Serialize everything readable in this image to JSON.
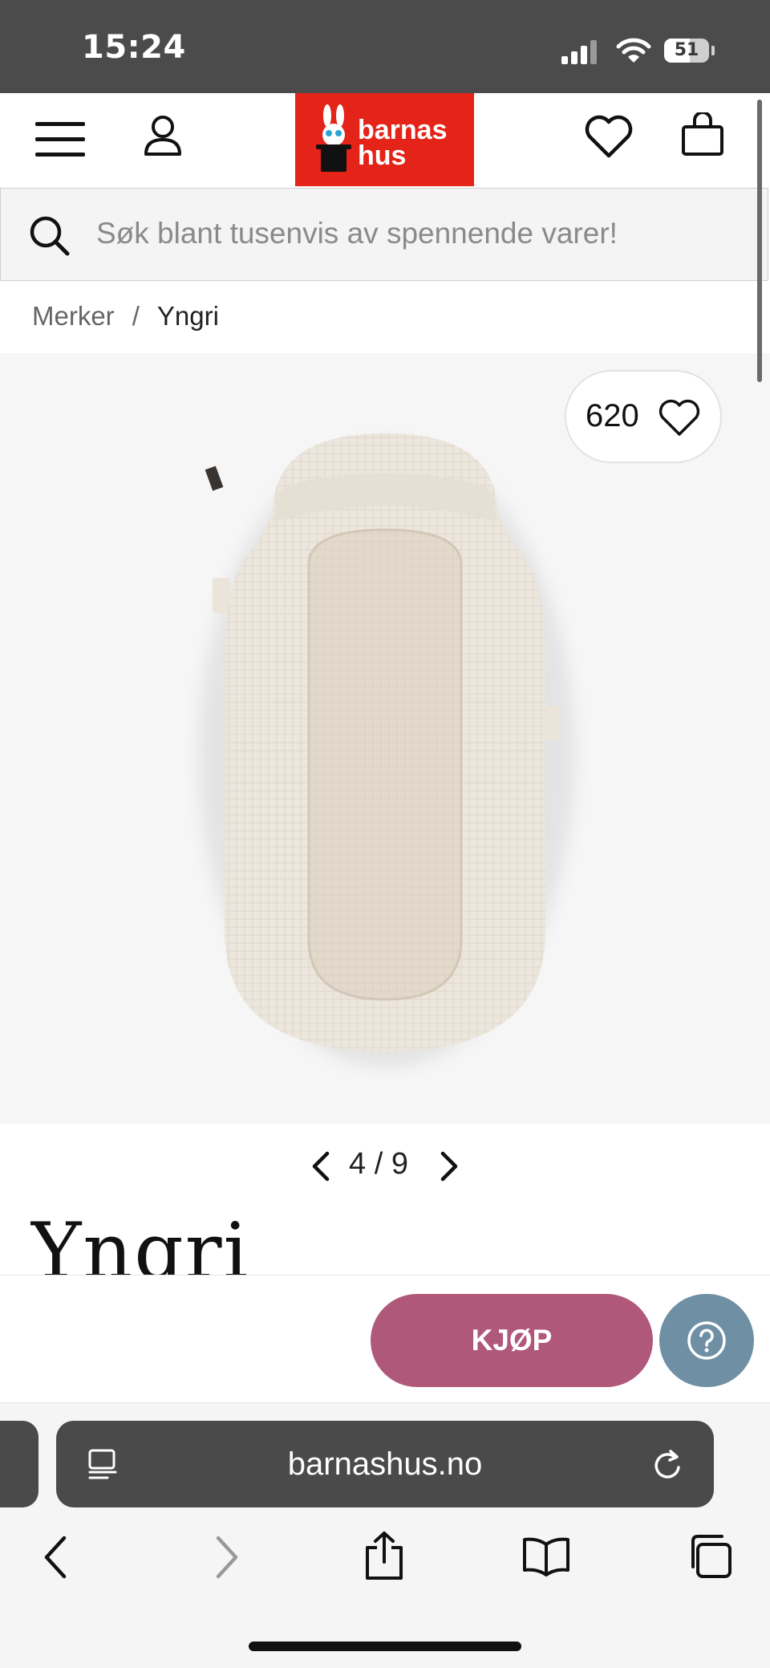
{
  "status_bar": {
    "time": "15:24",
    "battery": "51"
  },
  "header": {
    "logo_text_line1": "barnas",
    "logo_text_line2": "hus"
  },
  "search": {
    "placeholder": "Søk blant tusenvis av spennende varer!"
  },
  "breadcrumb": {
    "parent": "Merker",
    "separator": "/",
    "current": "Yngri"
  },
  "product": {
    "favorite_count": "620",
    "image_index": "4",
    "image_separator": "/",
    "image_total": "9",
    "brand_name": "Yngri"
  },
  "buy_bar": {
    "buy_label": "KJØP"
  },
  "browser": {
    "url": "barnashus.no"
  },
  "colors": {
    "status_bar": "#4b4b4b",
    "logo_red": "#e42319",
    "buy_button": "#b0587a",
    "help_button": "#6f8fa5",
    "url_bar": "#4a4a4a"
  }
}
